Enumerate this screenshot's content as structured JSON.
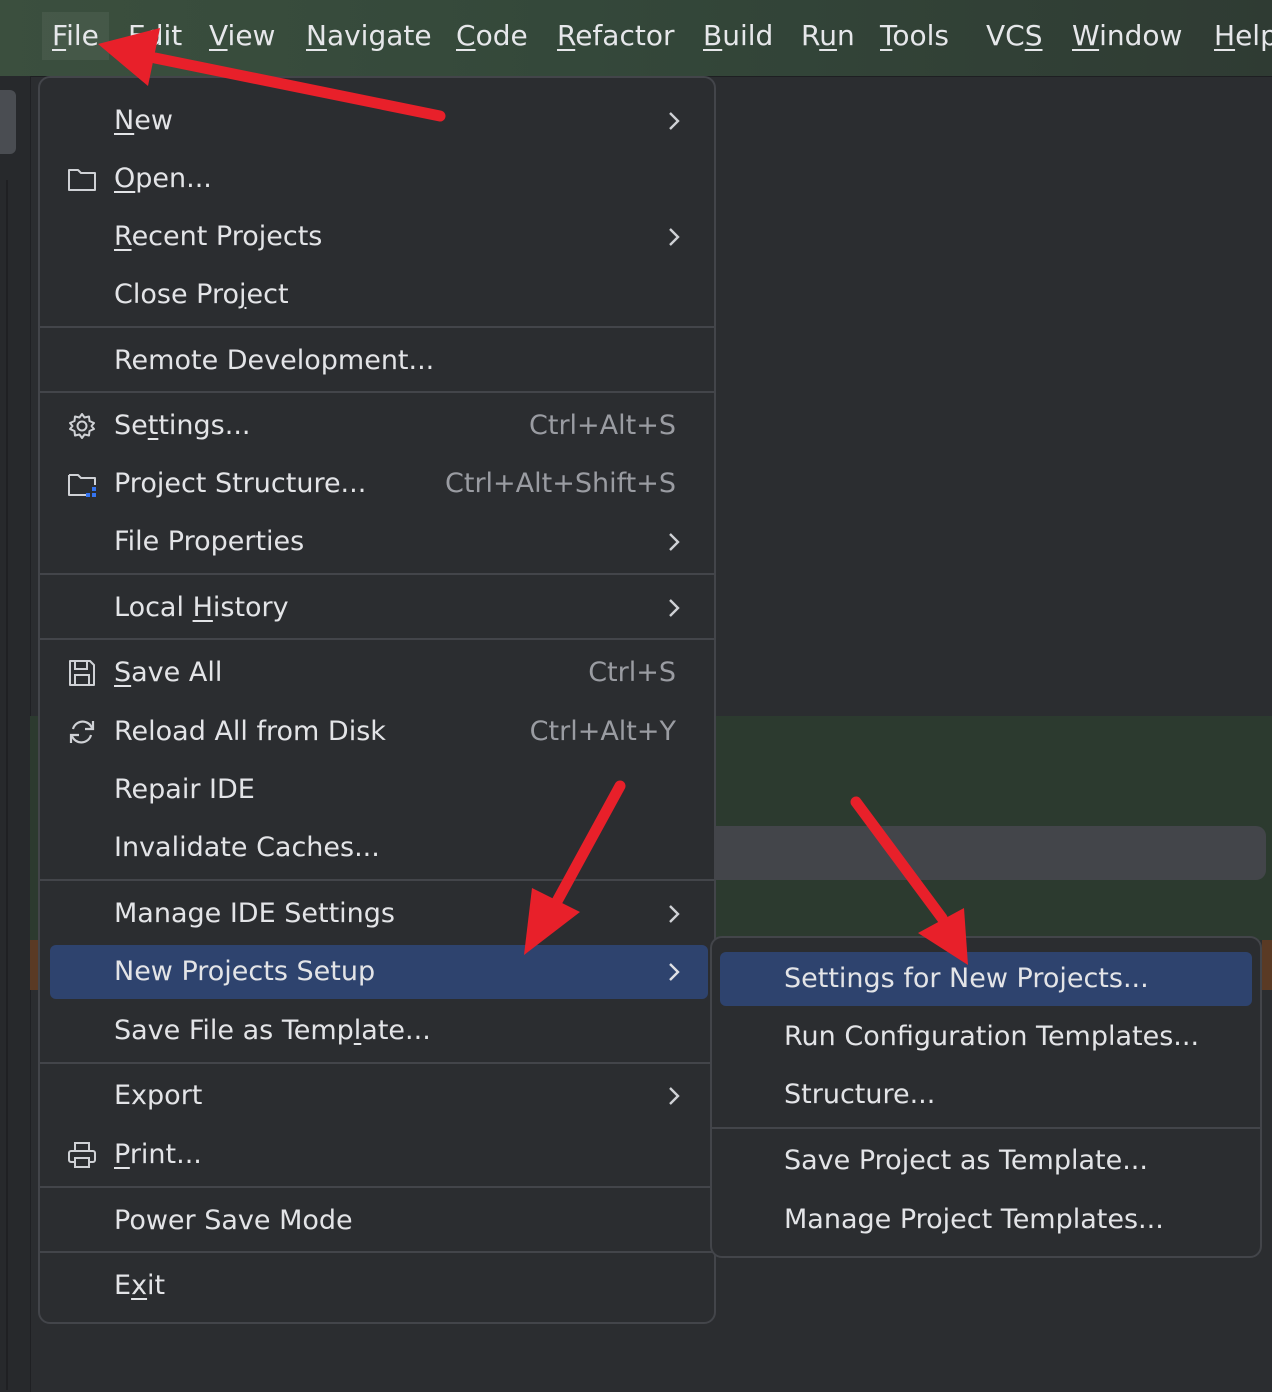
{
  "menubar": {
    "items": [
      {
        "label": "File",
        "mnemonic": "F",
        "rest": "ile"
      },
      {
        "label": "Edit",
        "mnemonic": "E",
        "rest": "dit"
      },
      {
        "label": "View",
        "mnemonic": "V",
        "rest": "iew"
      },
      {
        "label": "Navigate",
        "mnemonic": "N",
        "rest": "avigate"
      },
      {
        "label": "Code",
        "mnemonic": "C",
        "rest": "ode"
      },
      {
        "label": "Refactor",
        "mnemonic": "R",
        "rest": "efactor"
      },
      {
        "label": "Build",
        "mnemonic": "B",
        "rest": "uild"
      },
      {
        "label": "Run",
        "pre": "R",
        "mnemonic": "u",
        "rest": "n"
      },
      {
        "label": "Tools",
        "mnemonic": "T",
        "rest": "ools"
      },
      {
        "label": "VCS",
        "pre": "VC",
        "mnemonic": "S",
        "rest": ""
      },
      {
        "label": "Window",
        "mnemonic": "W",
        "rest": "indow"
      },
      {
        "label": "Help",
        "mnemonic": "H",
        "rest": "elp"
      }
    ]
  },
  "file_menu": {
    "new": {
      "pre": "",
      "mn": "N",
      "post": "ew"
    },
    "open": {
      "pre": "",
      "mn": "O",
      "post": "pen..."
    },
    "recent": {
      "pre": "",
      "mn": "R",
      "post": "ecent Projects"
    },
    "close": {
      "pre": "Close Pro",
      "mn": "j",
      "post": "ect"
    },
    "remote": {
      "label": "Remote Development..."
    },
    "settings": {
      "pre": "Se",
      "mn": "t",
      "post": "tings...",
      "shortcut": "Ctrl+Alt+S"
    },
    "project_structure": {
      "label": "Project Structure...",
      "shortcut": "Ctrl+Alt+Shift+S"
    },
    "file_properties": {
      "label": "File Properties"
    },
    "local_history": {
      "pre": "Local ",
      "mn": "H",
      "post": "istory"
    },
    "save_all": {
      "pre": "",
      "mn": "S",
      "post": "ave All",
      "shortcut": "Ctrl+S"
    },
    "reload": {
      "label": "Reload All from Disk",
      "shortcut": "Ctrl+Alt+Y"
    },
    "repair": {
      "label": "Repair IDE"
    },
    "invalidate": {
      "label": "Invalidate Caches..."
    },
    "manage_ide": {
      "label": "Manage IDE Settings"
    },
    "new_projects_setup": {
      "label": "New Projects Setup"
    },
    "save_template": {
      "pre": "Save File as Temp",
      "mn": "l",
      "post": "ate..."
    },
    "export": {
      "label": "Export"
    },
    "print": {
      "pre": "",
      "mn": "P",
      "post": "rint..."
    },
    "power_save": {
      "label": "Power Save Mode"
    },
    "exit": {
      "pre": "E",
      "mn": "x",
      "post": "it"
    }
  },
  "submenu": {
    "items": [
      "Settings for New Projects...",
      "Run Configuration Templates...",
      "Structure...",
      "Save Project as Template...",
      "Manage Project Templates..."
    ]
  },
  "colors": {
    "highlight": "#2e436e",
    "arrow": "#e8202a"
  }
}
